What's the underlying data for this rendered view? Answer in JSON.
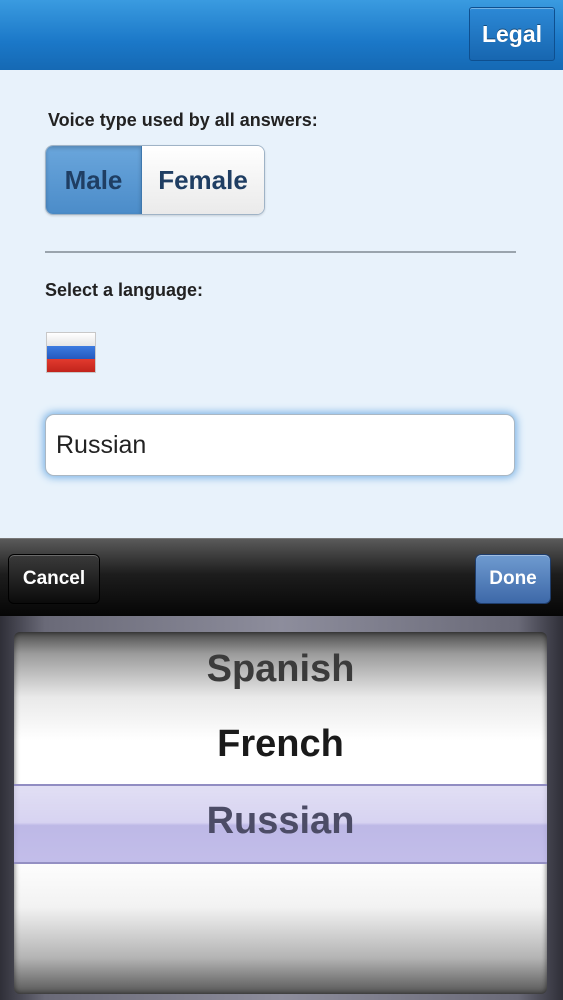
{
  "header": {
    "legal_label": "Legal"
  },
  "voice": {
    "label": "Voice type used by all answers:",
    "options": [
      "Male",
      "Female"
    ],
    "selected": "Male"
  },
  "language": {
    "label": "Select a language:",
    "flag_icon": "russia-flag-icon",
    "value": "Russian"
  },
  "toolbar": {
    "cancel_label": "Cancel",
    "done_label": "Done"
  },
  "picker": {
    "items": [
      "Spanish",
      "French",
      "Russian"
    ],
    "selected": "Russian"
  },
  "colors": {
    "header_blue": "#1b78c8",
    "selected_segment": "#4b8cc9",
    "done_button": "#3d68a8",
    "selection_bar": "#b8b2e6"
  }
}
